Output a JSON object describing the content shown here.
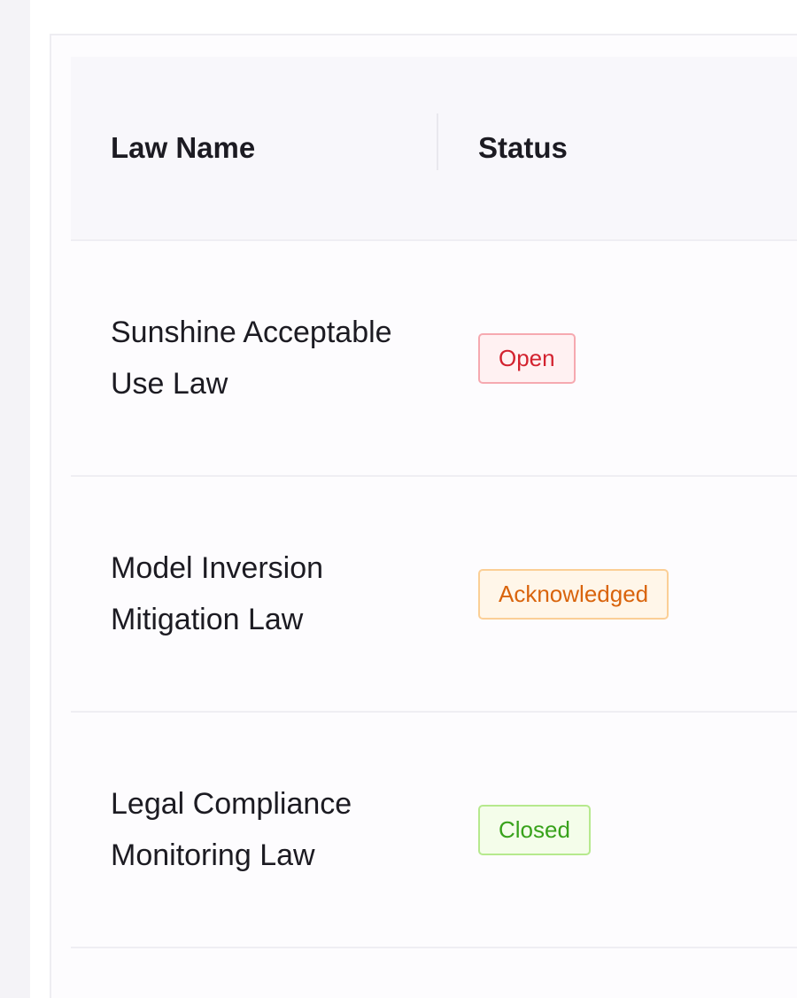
{
  "table": {
    "headers": {
      "law_name": "Law Name",
      "status": "Status"
    },
    "rows": [
      {
        "law_name": "Sunshine Acceptable Use Law",
        "status": "Open",
        "status_color": "#d3222f"
      },
      {
        "law_name": "Model Inversion Mitigation Law",
        "status": "Acknowledged",
        "status_color": "#d9640c"
      },
      {
        "law_name": "Legal Compliance Monitoring Law",
        "status": "Closed",
        "status_color": "#38a21b"
      }
    ]
  }
}
